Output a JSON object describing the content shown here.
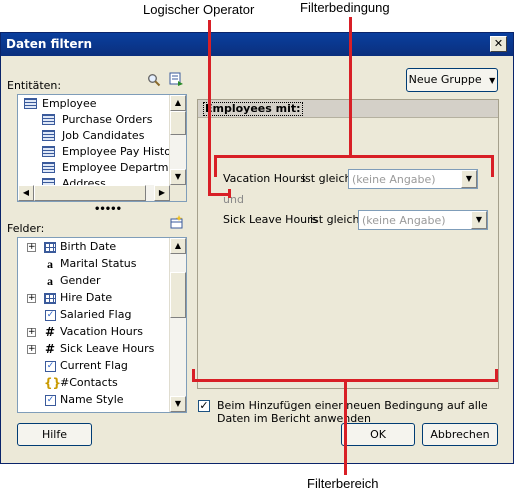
{
  "callouts": {
    "logical_operator": "Logischer Operator",
    "filter_condition": "Filterbedingung",
    "filter_area": "Filterbereich"
  },
  "dialog": {
    "title": "Daten filtern",
    "close_glyph": "✕"
  },
  "entities": {
    "label": "Entitäten:",
    "items": [
      "Employee",
      "Purchase Orders",
      "Job Candidates",
      "Employee Pay Histories",
      "Employee Department",
      "Address"
    ]
  },
  "fields": {
    "label": "Felder:",
    "items": [
      {
        "label": "Birth Date",
        "icon": "calendar-table-icon"
      },
      {
        "label": "Marital Status",
        "icon": "text-a-icon"
      },
      {
        "label": "Gender",
        "icon": "text-a-icon"
      },
      {
        "label": "Hire Date",
        "icon": "calendar-table-icon"
      },
      {
        "label": "Salaried Flag",
        "icon": "boolean-icon"
      },
      {
        "label": "Vacation Hours",
        "icon": "number-hash-icon"
      },
      {
        "label": "Sick Leave Hours",
        "icon": "number-hash-icon"
      },
      {
        "label": "Current Flag",
        "icon": "boolean-icon"
      },
      {
        "label": "#Contacts",
        "icon": "aggregate-brace-icon"
      },
      {
        "label": "Name Style",
        "icon": "boolean-icon"
      }
    ]
  },
  "toolbar": {
    "new_group_label": "Neue Gruppe"
  },
  "filter": {
    "header": "Employees mit:",
    "conditions": [
      {
        "field": "Vacation Hours",
        "operator": "ist gleich",
        "value": "(keine Angabe)"
      },
      {
        "field": "Sick Leave Hours",
        "operator": "ist gleich",
        "value": "(keine Angabe)"
      }
    ],
    "logical_operator": "und"
  },
  "options": {
    "apply_all_text": "Beim Hinzufügen einer neuen Bedingung auf alle Daten im Bericht anwenden",
    "apply_all_checked": true
  },
  "buttons": {
    "help": "Hilfe",
    "ok": "OK",
    "cancel": "Abbrechen"
  },
  "colors": {
    "callout_red": "#d81f26",
    "titlebar": "#0b2f7d",
    "dialog_bg": "#ece9d8"
  }
}
